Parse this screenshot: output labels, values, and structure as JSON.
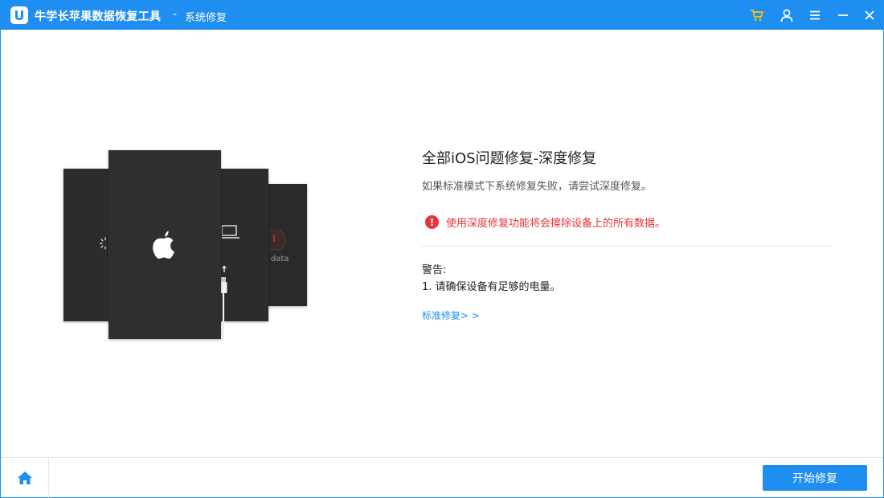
{
  "titlebar": {
    "app_title": "牛学长苹果数据恢复工具",
    "separator": "-",
    "page_name": "系统修复",
    "icons": [
      "cart-icon",
      "user-icon",
      "menu-icon",
      "minimize-icon",
      "close-icon"
    ],
    "cart_color": "#ffc107",
    "bar_color": "#1e8ef0"
  },
  "illustration": {
    "data_label": "data",
    "icons": [
      "spinner-icon",
      "apple-logo-icon",
      "laptop-icon",
      "arrow-up-icon",
      "usb-cable-icon",
      "warning-triangle-icon"
    ]
  },
  "main": {
    "heading": "全部iOS问题修复-深度修复",
    "description": "如果标准模式下系统修复失败，请尝试深度修复。",
    "warning_text": "使用深度修复功能将会擦除设备上的所有数据。",
    "warning_color": "#e8323c",
    "notice_title": "警告:",
    "notice_item": "1. 请确保设备有足够的电量。",
    "standard_link": "标准修复> >"
  },
  "footer": {
    "start_button": "开始修复"
  }
}
